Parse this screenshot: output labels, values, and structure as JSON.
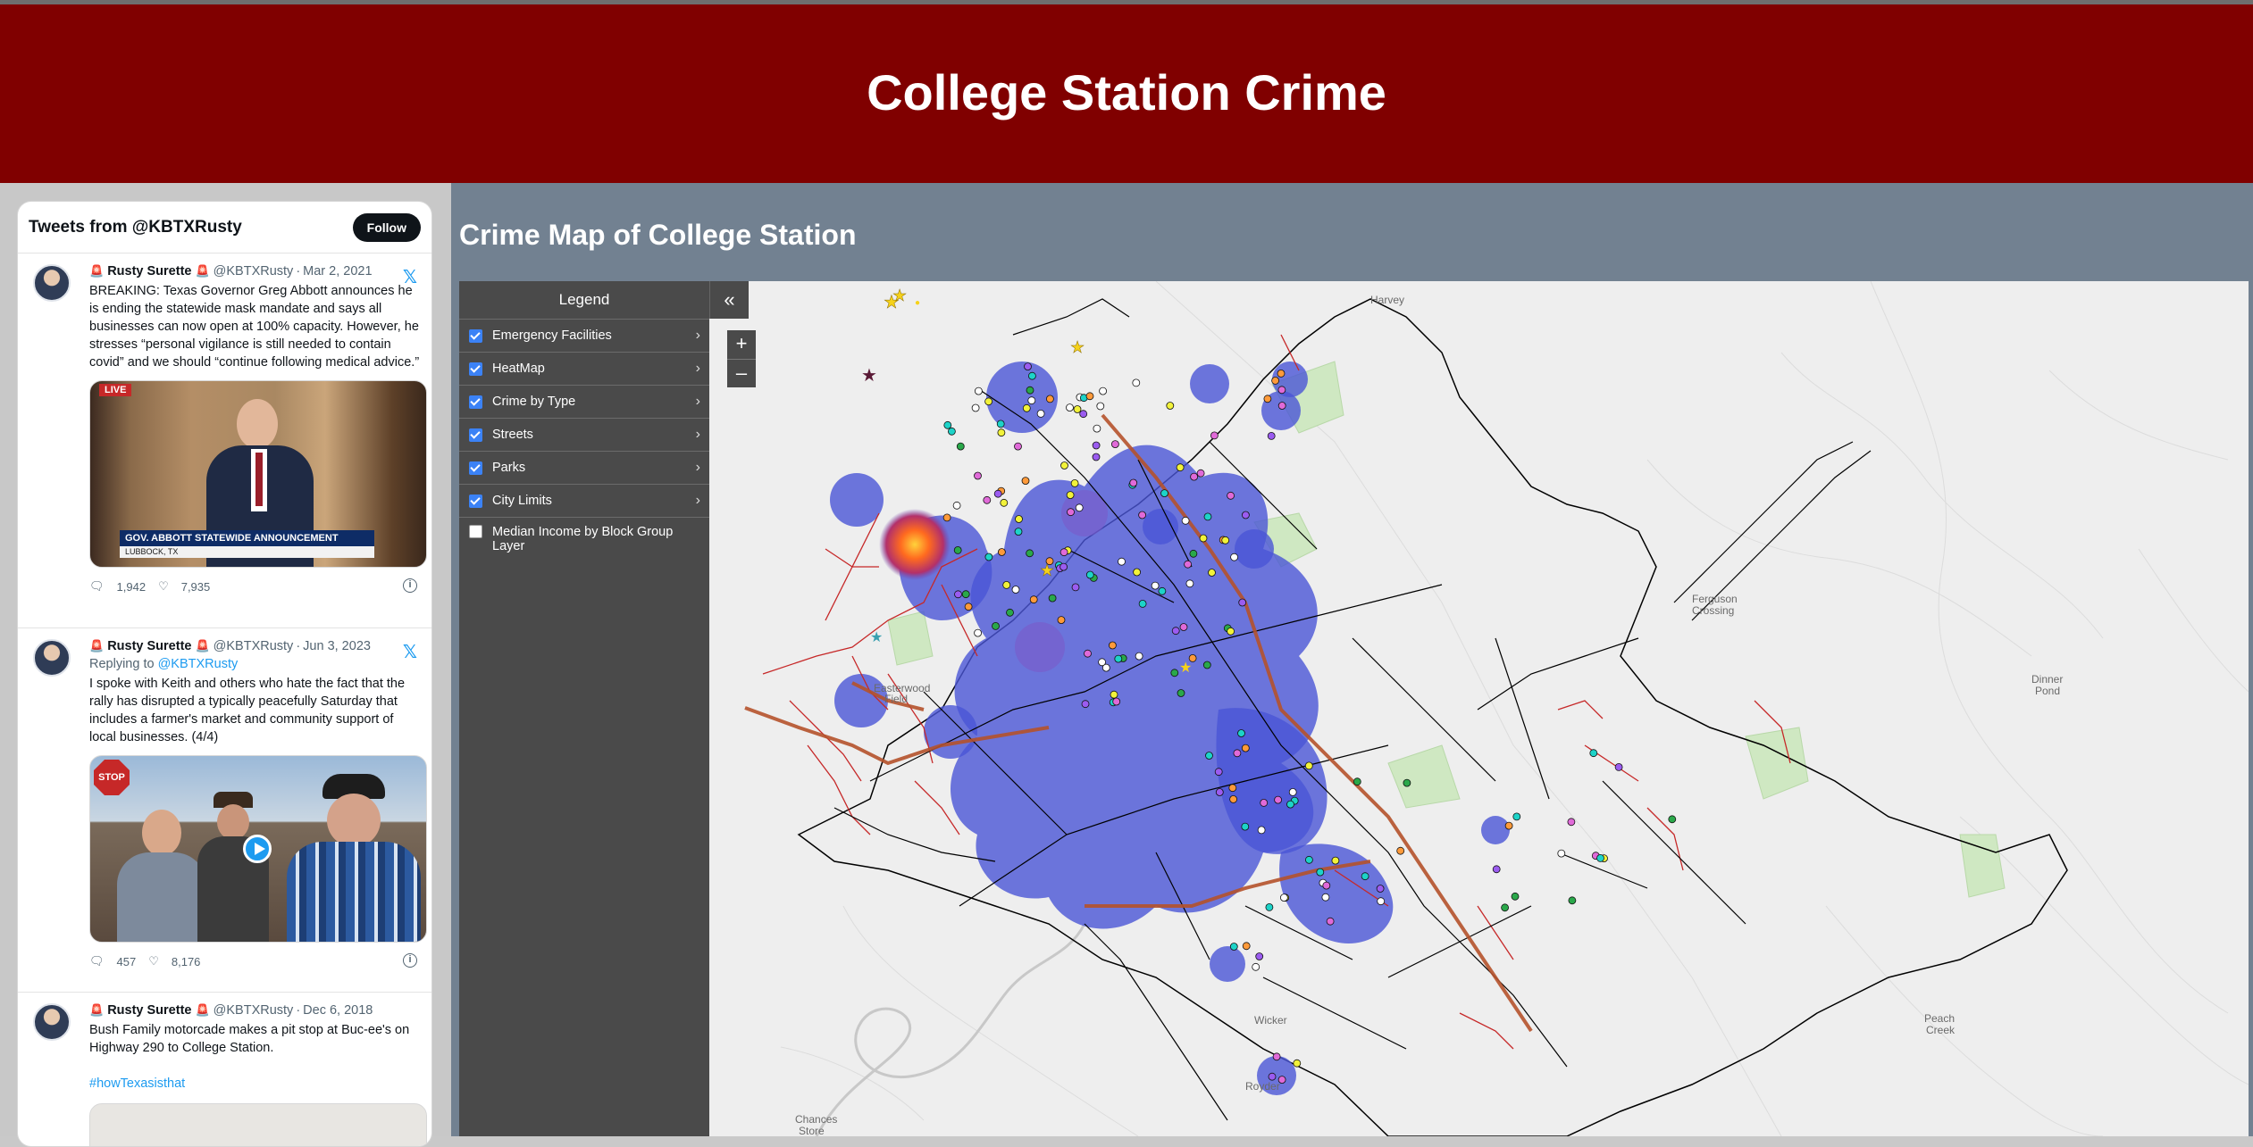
{
  "header": {
    "title": "College Station Crime"
  },
  "tweets_widget": {
    "title": "Tweets from @KBTXRusty",
    "follow_label": "Follow",
    "tweets": [
      {
        "name": "Rusty Surette",
        "handle": "@KBTXRusty",
        "date": "Mar 2, 2021",
        "text": "BREAKING: Texas Governor Greg Abbott announces he is ending the statewide mask mandate and says all businesses can now open at 100% capacity. However, he stresses “personal vigilance is still needed to contain covid” and we should “continue following medical advice.”",
        "media": {
          "live_badge": "LIVE",
          "banner": "GOV. ABBOTT STATEWIDE ANNOUNCEMENT",
          "sub_banner": "LUBBOCK, TX"
        },
        "replies": "1,942",
        "likes": "7,935"
      },
      {
        "name": "Rusty Surette",
        "handle": "@KBTXRusty",
        "date": "Jun 3, 2023",
        "reply_prefix": "Replying to",
        "reply_to": "@KBTXRusty",
        "text": "I spoke with Keith and others who hate the fact that the rally has disrupted a typically peacefully Saturday that includes a farmer's market and community support of local businesses. (4/4)",
        "media": {
          "stop_sign": "STOP"
        },
        "replies": "457",
        "likes": "8,176"
      },
      {
        "name": "Rusty Surette",
        "handle": "@KBTXRusty",
        "date": "Dec 6, 2018",
        "text": "Bush Family motorcade makes a pit stop at Buc-ee's on Highway 290 to College Station.",
        "hashtag": "#howTexasisthat"
      }
    ]
  },
  "main": {
    "title": "Crime Map of College Station"
  },
  "legend": {
    "title": "Legend",
    "items": [
      {
        "label": "Emergency Facilities",
        "checked": true
      },
      {
        "label": "HeatMap",
        "checked": true
      },
      {
        "label": "Crime by Type",
        "checked": true
      },
      {
        "label": "Streets",
        "checked": true
      },
      {
        "label": "Parks",
        "checked": true
      },
      {
        "label": "City Limits",
        "checked": true
      },
      {
        "label": "Median Income by Block Group Layer",
        "checked": false
      }
    ],
    "collapse_icon": "«",
    "zoom_in": "+",
    "zoom_out": "–"
  },
  "map_labels": {
    "harvey": "Harvey",
    "ferguson": "Ferguson",
    "crossing": "Crossing",
    "dinner": "Dinner",
    "pond": "Pond",
    "peach": "Peach",
    "creek": "Creek",
    "wicker": "Wicker",
    "royder": "Royder",
    "chances": "Chances",
    "store": "Store",
    "easterwood": "Easterwood",
    "field": "Field"
  },
  "colors": {
    "header_bg": "#800000",
    "main_bg": "#728191",
    "legend_bg": "#4a4a4a",
    "heatmap": "#4a55d6",
    "streets": "#000000",
    "red_streets": "#c62828",
    "highway": "#b5522b",
    "parks": "#cfe8c2"
  }
}
